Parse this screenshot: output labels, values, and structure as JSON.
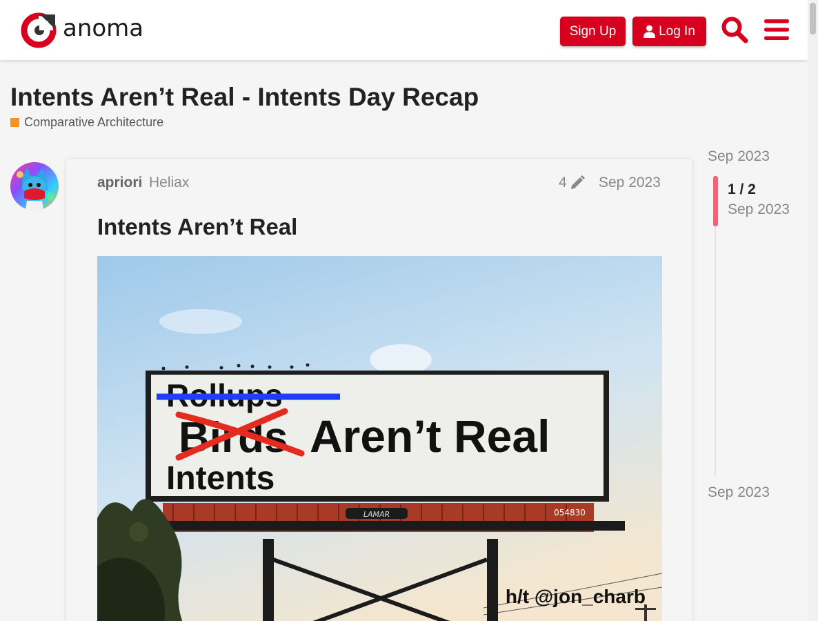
{
  "header": {
    "logo_text": "anoma",
    "signup_label": "Sign Up",
    "login_label": "Log In",
    "icons": [
      "search-icon",
      "hamburger-menu-icon",
      "user-icon"
    ]
  },
  "topic": {
    "title": "Intents Aren’t Real - Intents Day Recap",
    "category": "Comparative Architecture",
    "category_color": "#f7941d"
  },
  "post": {
    "username": "apriori",
    "user_title": "Heliax",
    "edit_count": "4",
    "date": "Sep 2023",
    "heading": "Intents Aren’t Real",
    "image": {
      "line_crossed_blue": "Rollups",
      "line_crossed_red": "Birds",
      "main_text": "Aren’t Real",
      "replacement": "Intents",
      "brand": "LAMAR",
      "panel_number": "054830",
      "credit": "h/t @jon_charb"
    }
  },
  "timeline": {
    "top_date": "Sep 2023",
    "position": "1 / 2",
    "handle_date": "Sep 2023",
    "bottom_date": "Sep 2023"
  },
  "colors": {
    "brand_red": "#d7001e",
    "timeline_handle": "#ef6577"
  }
}
